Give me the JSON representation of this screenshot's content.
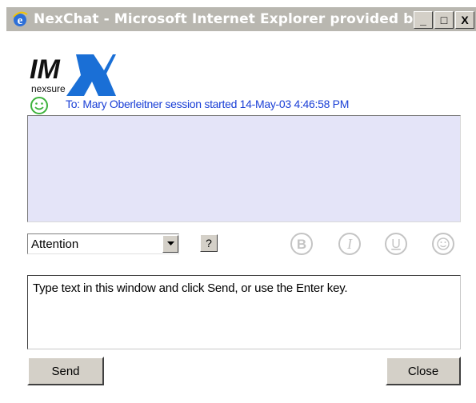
{
  "window": {
    "title": "NexChat - Microsoft Internet Explorer provided b...",
    "controls": {
      "minimize": "_",
      "maximize": "□",
      "close": "X"
    }
  },
  "logo": {
    "brand": "IMX",
    "sub": "nexsure"
  },
  "session": {
    "line": "To: Mary Oberleitner session started 14-May-03 4:46:58 PM"
  },
  "message_type": {
    "selected": "Attention",
    "help": "?"
  },
  "format": {
    "bold": "B",
    "italic": "I",
    "underline": "U"
  },
  "compose": {
    "text": "Type text in this window and click Send, or use the Enter key."
  },
  "buttons": {
    "send": "Send",
    "close": "Close"
  },
  "colors": {
    "titlebar": "#b9b7b0",
    "session_text": "#1a3fd6",
    "history_bg": "#e4e4f8",
    "logo_blue": "#1a6fd6",
    "format_icon": "#c4c4c4"
  }
}
